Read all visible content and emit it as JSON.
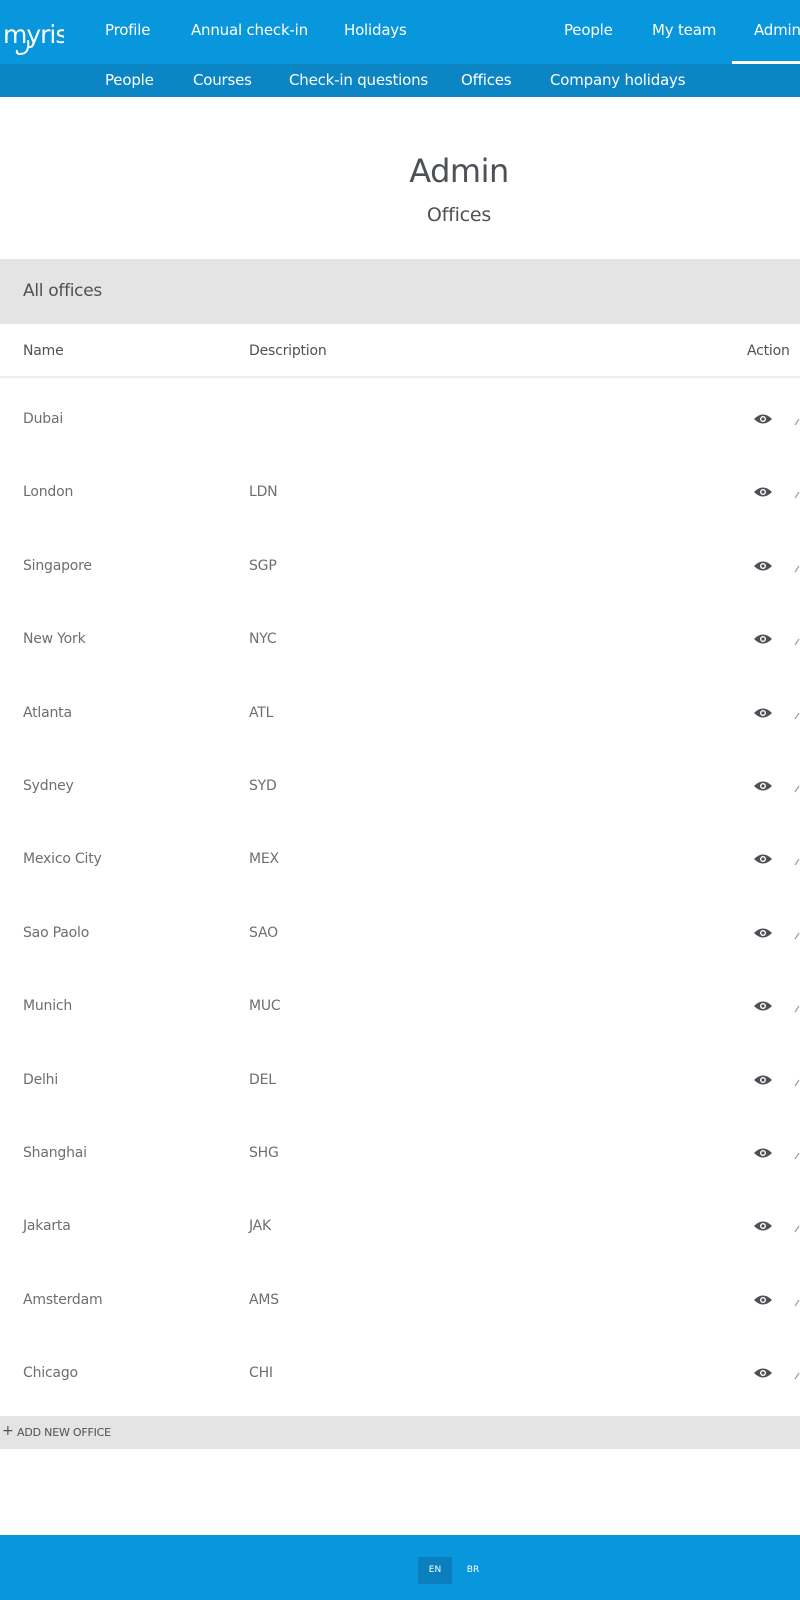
{
  "brand": {
    "logo_text": "myris",
    "primary_color": "#0896dc",
    "subnav_color": "#0b85c3"
  },
  "topnav": {
    "items": [
      {
        "label": "Profile"
      },
      {
        "label": "Annual check-in"
      },
      {
        "label": "Holidays"
      },
      {
        "label": "People"
      },
      {
        "label": "My team"
      },
      {
        "label": "Admin",
        "active": true
      }
    ]
  },
  "subnav": {
    "items": [
      {
        "label": "People"
      },
      {
        "label": "Courses"
      },
      {
        "label": "Check-in questions"
      },
      {
        "label": "Offices",
        "active": true
      },
      {
        "label": "Company holidays"
      }
    ]
  },
  "page": {
    "title": "Admin",
    "subtitle": "Offices"
  },
  "section": {
    "title": "All offices"
  },
  "table": {
    "columns": {
      "name": "Name",
      "description": "Description",
      "action": "Action"
    },
    "action_icon": "eye-icon",
    "rows": [
      {
        "name": "Dubai",
        "description": ""
      },
      {
        "name": "London",
        "description": "LDN"
      },
      {
        "name": "Singapore",
        "description": "SGP"
      },
      {
        "name": "New York",
        "description": "NYC"
      },
      {
        "name": "Atlanta",
        "description": "ATL"
      },
      {
        "name": "Sydney",
        "description": "SYD"
      },
      {
        "name": "Mexico City",
        "description": "MEX"
      },
      {
        "name": "Sao Paolo",
        "description": "SAO"
      },
      {
        "name": "Munich",
        "description": "MUC"
      },
      {
        "name": "Delhi",
        "description": "DEL"
      },
      {
        "name": "Shanghai",
        "description": "SHG"
      },
      {
        "name": "Jakarta",
        "description": "JAK"
      },
      {
        "name": "Amsterdam",
        "description": "AMS"
      },
      {
        "name": "Chicago",
        "description": "CHI"
      }
    ]
  },
  "add_office": {
    "icon": "plus-icon",
    "label": "ADD NEW OFFICE"
  },
  "footer": {
    "languages": [
      {
        "code": "EN",
        "selected": true
      },
      {
        "code": "BR",
        "selected": false
      }
    ]
  }
}
